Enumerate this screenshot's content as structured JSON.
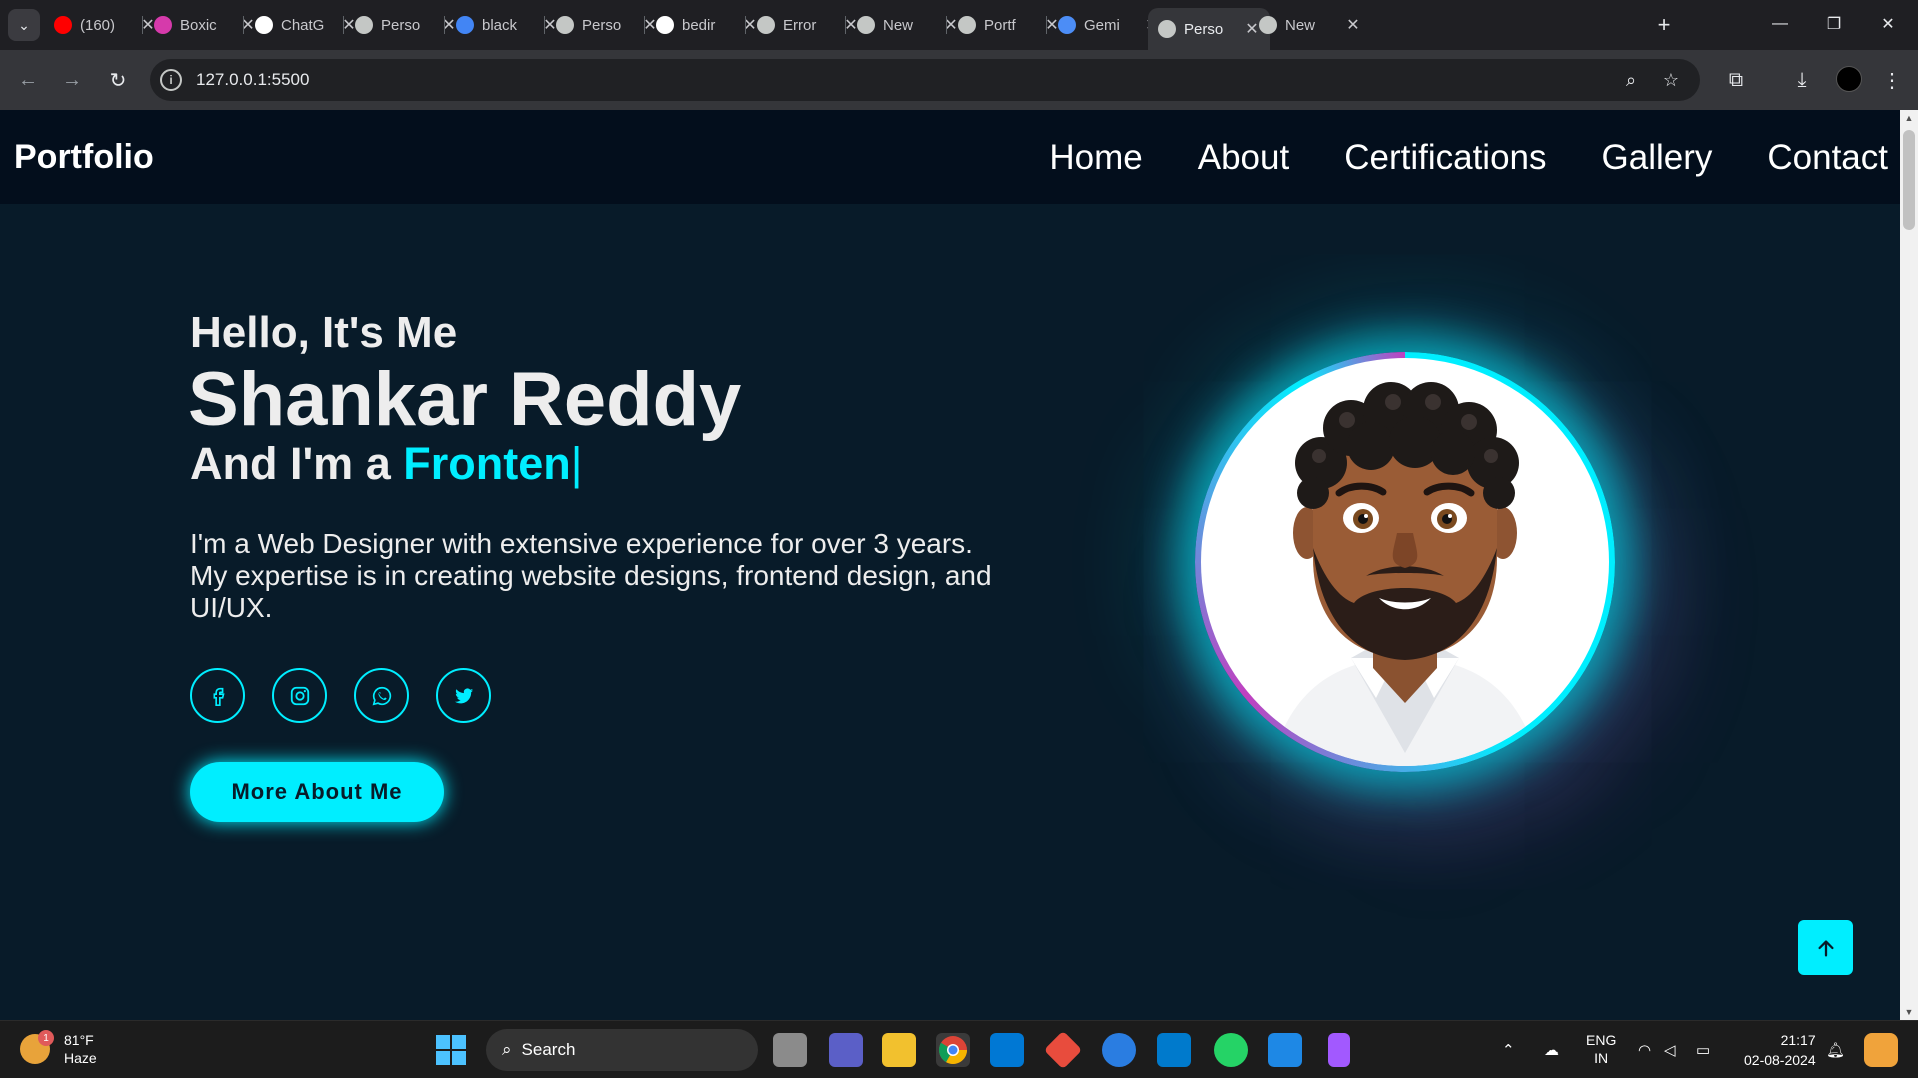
{
  "browser": {
    "tabs": [
      {
        "title": "(160)",
        "favicon": "youtube-icon",
        "color": "#ff0000"
      },
      {
        "title": "Boxic",
        "favicon": "boxicons-icon",
        "color": "#d63aab"
      },
      {
        "title": "ChatG",
        "favicon": "chatgpt-icon",
        "color": "#ffffff"
      },
      {
        "title": "Perso",
        "favicon": "globe-icon",
        "color": "#c4c7c5"
      },
      {
        "title": "black",
        "favicon": "google-icon",
        "color": "#4285f4"
      },
      {
        "title": "Perso",
        "favicon": "globe-icon",
        "color": "#c4c7c5"
      },
      {
        "title": "bedir",
        "favicon": "github-icon",
        "color": "#ffffff"
      },
      {
        "title": "Error",
        "favicon": "globe-icon",
        "color": "#c4c7c5"
      },
      {
        "title": "New",
        "favicon": "chrome-icon",
        "color": "#c4c7c5"
      },
      {
        "title": "Portf",
        "favicon": "globe-icon",
        "color": "#c4c7c5"
      },
      {
        "title": "Gemi",
        "favicon": "gemini-icon",
        "color": "#4c8df6"
      },
      {
        "title": "Perso",
        "favicon": "globe-icon",
        "color": "#c4c7c5",
        "active": true
      },
      {
        "title": "New",
        "favicon": "chrome-icon",
        "color": "#c4c7c5"
      }
    ],
    "url": "127.0.0.1:5500"
  },
  "page": {
    "logo": "Portfolio",
    "nav": [
      "Home",
      "About",
      "Certifications",
      "Gallery",
      "Contact"
    ],
    "hello": "Hello, It's Me",
    "name": "Shankar Reddy",
    "role_prefix": "And I'm a ",
    "role_typed": "Fronten",
    "role_cursor": "|",
    "description": "I'm a Web Designer with extensive experience for over 3 years. My expertise is in creating website designs, frontend design, and UI/UX.",
    "socials": [
      "facebook-icon",
      "instagram-icon",
      "whatsapp-icon",
      "twitter-icon"
    ],
    "cta": "More About Me",
    "accent": "#00eeff",
    "background": "#081b29"
  },
  "taskbar": {
    "weather_temp": "81°F",
    "weather_desc": "Haze",
    "weather_badge": "1",
    "search": "Search",
    "lang_top": "ENG",
    "lang_bottom": "IN",
    "time": "21:17",
    "date": "02-08-2024"
  }
}
